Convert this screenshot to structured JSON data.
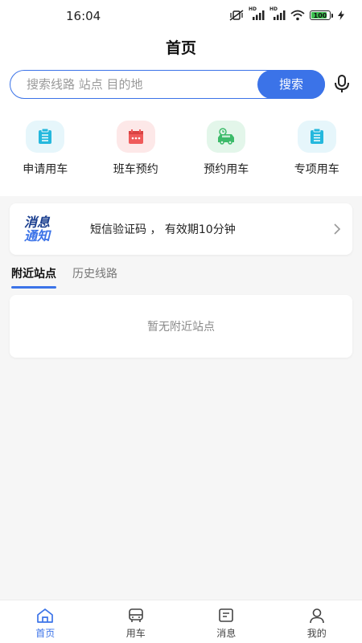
{
  "status": {
    "time": "16:04",
    "battery": "100",
    "net1": "HD",
    "net2": "HD"
  },
  "header": {
    "title": "首页"
  },
  "search": {
    "placeholder": "搜索线路 站点 目的地",
    "button": "搜索"
  },
  "quick": [
    {
      "label": "申请用车",
      "icon": "clipboard-icon",
      "bg": "#e6f6fb",
      "fg": "#25b8dd"
    },
    {
      "label": "班车预约",
      "icon": "calendar-icon",
      "bg": "#fde8e8",
      "fg": "#ef5a5a"
    },
    {
      "label": "预约用车",
      "icon": "car-clock-icon",
      "bg": "#e3f6ea",
      "fg": "#3dbb6a"
    },
    {
      "label": "专项用车",
      "icon": "clipboard-icon",
      "bg": "#e6f6fb",
      "fg": "#25b8dd"
    }
  ],
  "notice": {
    "logo_line1": "消息",
    "logo_line2": "通知",
    "text": "短信验证码 ， 有效期10分钟"
  },
  "tabs": [
    {
      "label": "附近站点"
    },
    {
      "label": "历史线路"
    }
  ],
  "empty": {
    "text": "暂无附近站点"
  },
  "bottom_nav": [
    {
      "label": "首页",
      "icon": "home-icon"
    },
    {
      "label": "用车",
      "icon": "bus-icon"
    },
    {
      "label": "消息",
      "icon": "message-icon"
    },
    {
      "label": "我的",
      "icon": "user-icon"
    }
  ],
  "colors": {
    "accent": "#3b73e8"
  }
}
